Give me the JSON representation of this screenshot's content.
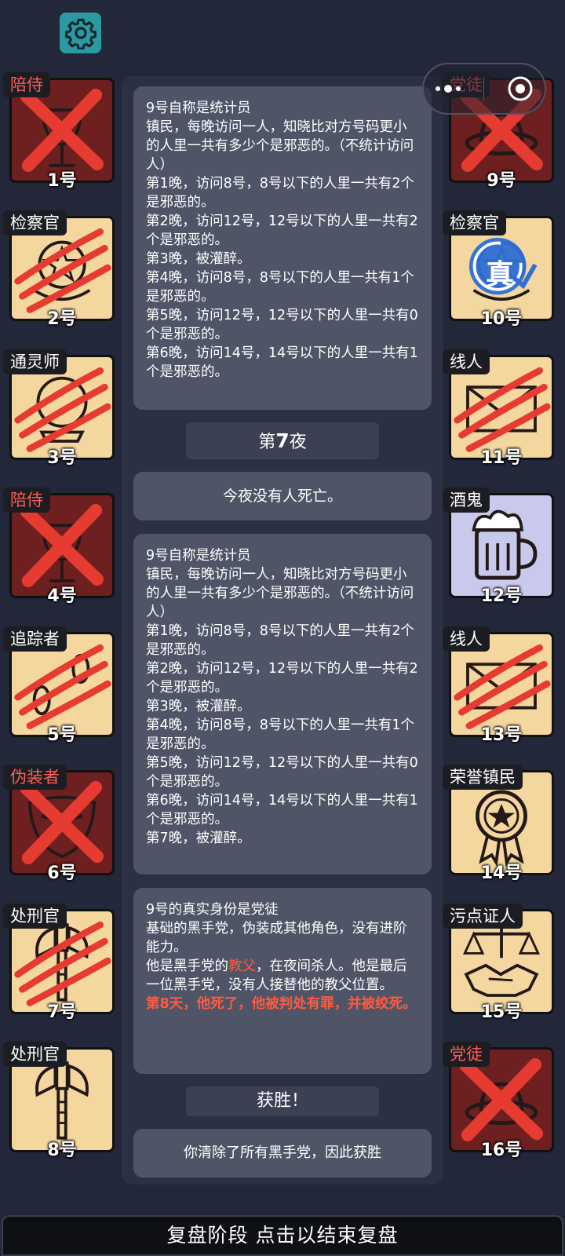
{
  "top": {
    "settings_icon": "gear-icon",
    "capsule_partial_text": "党徒"
  },
  "players_left": [
    {
      "role": "陪侍",
      "num": "1号",
      "state": "dead-x",
      "icon": "wine-glass-icon"
    },
    {
      "role": "检察官",
      "num": "2号",
      "state": "claw",
      "icon": "badge-icon"
    },
    {
      "role": "通灵师",
      "num": "3号",
      "state": "claw",
      "icon": "crystal-ball-icon"
    },
    {
      "role": "陪侍",
      "num": "4号",
      "state": "dead-x",
      "icon": "wine-glass-icon"
    },
    {
      "role": "追踪者",
      "num": "5号",
      "state": "claw",
      "icon": "footprints-icon"
    },
    {
      "role": "伪装者",
      "num": "6号",
      "state": "dead-x",
      "icon": "mask-icon"
    },
    {
      "role": "处刑官",
      "num": "7号",
      "state": "claw",
      "icon": "axe-icon"
    },
    {
      "role": "处刑官",
      "num": "8号",
      "state": "alive",
      "icon": "axe-icon"
    }
  ],
  "players_right": [
    {
      "role": "党徒",
      "num": "9号",
      "state": "dead-x",
      "icon": "hat-icon"
    },
    {
      "role": "检察官",
      "num": "10号",
      "state": "true-stamp",
      "icon": "badge-icon",
      "stamp": "真"
    },
    {
      "role": "线人",
      "num": "11号",
      "state": "claw",
      "icon": "envelope-icon"
    },
    {
      "role": "酒鬼",
      "num": "12号",
      "state": "alive-purple",
      "icon": "beer-mug-icon"
    },
    {
      "role": "线人",
      "num": "13号",
      "state": "claw",
      "icon": "envelope-icon"
    },
    {
      "role": "荣誉镇民",
      "num": "14号",
      "state": "alive",
      "icon": "medal-icon"
    },
    {
      "role": "污点证人",
      "num": "15号",
      "state": "alive",
      "icon": "scales-handshake-icon"
    },
    {
      "role": "党徒",
      "num": "16号",
      "state": "dead-x",
      "icon": "hat-icon"
    }
  ],
  "log": {
    "msg1": "9号自称是统计员\n镇民，每晚访问一人，知晓比对方号码更小的人里一共有多少个是邪恶的。（不统计访问人）\n第1晚，访问8号，8号以下的人里一共有2个是邪恶的。\n第2晚，访问12号，12号以下的人里一共有2个是邪恶的。\n第3晚，被灌醉。\n第4晚，访问8号，8号以下的人里一共有1个是邪恶的。\n第5晚，访问12号，12号以下的人里一共有0个是邪恶的。\n第6晚，访问14号，14号以下的人里一共有1个是邪恶的。",
    "night_title_pre": "第",
    "night_title_num": "7",
    "night_title_post": "夜",
    "no_death": "今夜没有人死亡。",
    "msg2": "9号自称是统计员\n镇民，每晚访问一人，知晓比对方号码更小的人里一共有多少个是邪恶的。（不统计访问人）\n第1晚，访问8号，8号以下的人里一共有2个是邪恶的。\n第2晚，访问12号，12号以下的人里一共有2个是邪恶的。\n第3晚，被灌醉。\n第4晚，访问8号，8号以下的人里一共有1个是邪恶的。\n第5晚，访问12号，12号以下的人里一共有0个是邪恶的。\n第6晚，访问14号，14号以下的人里一共有1个是邪恶的。\n第7晚，被灌醉。",
    "reveal_line1": "9号的真实身份是党徒",
    "reveal_line2": "基础的黑手党，伪装成其他角色，没有进阶能力。",
    "reveal_line3a": "他是黑手党的",
    "reveal_line3_red": "教父",
    "reveal_line3b": "，在夜间杀人。他是最后一位黑手党，没有人接替他的教父位置。",
    "reveal_death": "第8天，他死了，他被判处有罪，并被绞死。",
    "victory_title": "获胜！",
    "victory_msg": "你清除了所有黑手党，因此获胜"
  },
  "bottom_bar": "复盘阶段 点击以结束复盘",
  "colors": {
    "dead_bg": "#6e1f20",
    "alive_bg": "#f4d69f",
    "red_x": "#e53b30",
    "panel": "#2c3043",
    "msg": "#4f5567"
  }
}
